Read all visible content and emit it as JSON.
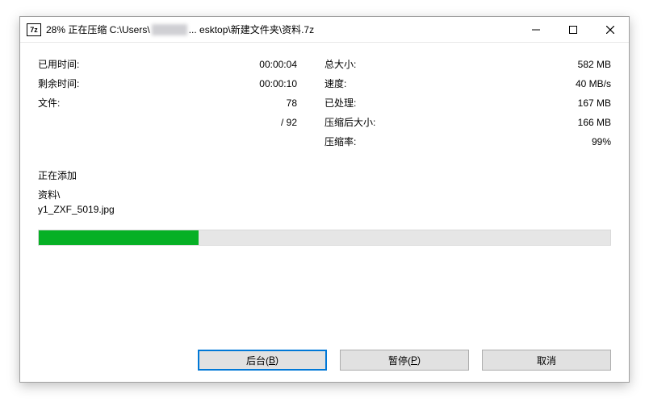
{
  "title": {
    "prefix": "28% 正在压缩 C:\\Users\\",
    "suffix": " ... esktop\\新建文件夹\\资料.7z"
  },
  "icon7z": "7z",
  "labels": {
    "elapsed": "已用时间:",
    "remaining": "剩余时间:",
    "files": "文件:",
    "total_count_sep": "/ 92",
    "total_size": "总大小:",
    "speed": "速度:",
    "processed": "已处理:",
    "compressed_size": "压缩后大小:",
    "ratio": "压缩率:",
    "adding": "正在添加"
  },
  "values": {
    "elapsed": "00:00:04",
    "remaining": "00:00:10",
    "files": "78",
    "total_size": "582 MB",
    "speed": "40 MB/s",
    "processed": "167 MB",
    "compressed_size": "166 MB",
    "ratio": "99%"
  },
  "current_file": {
    "folder": "资料\\",
    "name": "y1_ZXF_5019.jpg"
  },
  "progress_percent": 28,
  "buttons": {
    "background_pre": "后台(",
    "background_u": "B",
    "background_post": ")",
    "pause_pre": "暂停(",
    "pause_u": "P",
    "pause_post": ")",
    "cancel": "取消"
  }
}
